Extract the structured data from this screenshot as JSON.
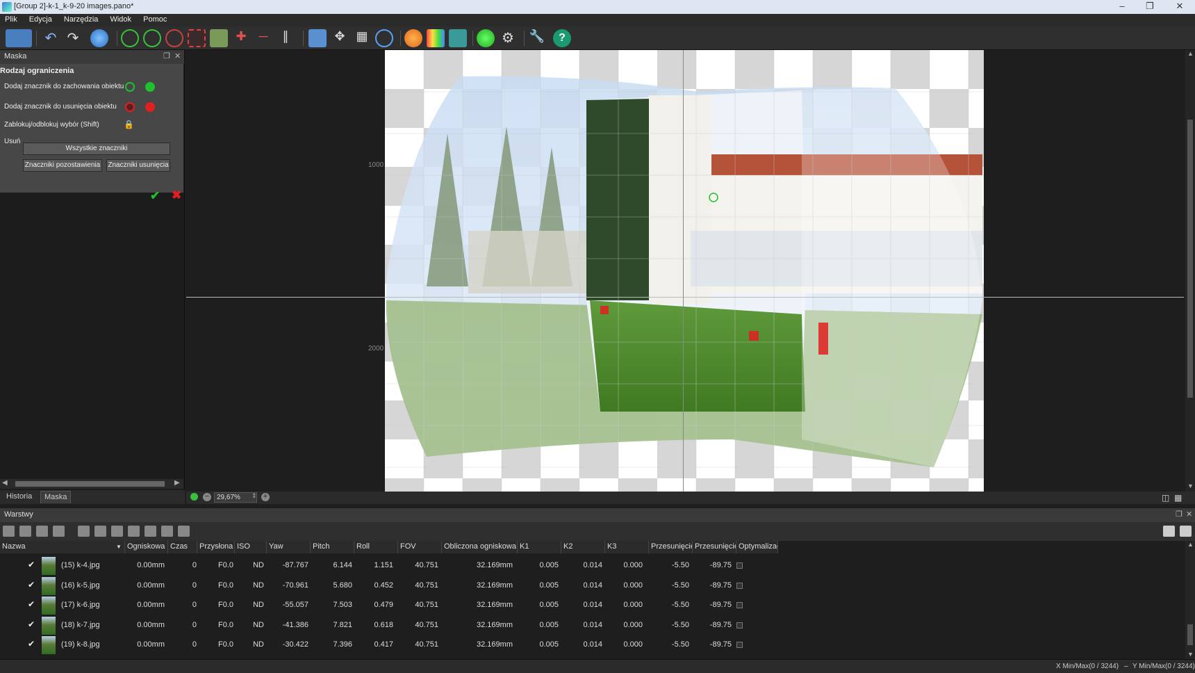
{
  "window": {
    "title": "[Group 2]-k-1_k-9-20 images.pano*"
  },
  "menu": [
    "Plik",
    "Edycja",
    "Narzędzia",
    "Widok",
    "Pomoc"
  ],
  "mask_panel": {
    "title": "Maska",
    "section_title": "Rodzaj ograniczenia",
    "keep_label": "Dodaj znacznik do zachowania obiektu",
    "remove_label": "Dodaj znacznik do usunięcia obiektu",
    "lock_label": "Zablokuj/odblokuj wybór (Shift)",
    "delete_label": "Usuń",
    "all_markers_button": "Wszystkie znaczniki",
    "keep_markers_button": "Znaczniki pozostawienia",
    "remove_markers_button": "Znaczniki usunięcia"
  },
  "left_tabs": [
    "Historia",
    "Maska"
  ],
  "viewport": {
    "ruler_labels": [
      "1000",
      "2000"
    ],
    "zoom": "29,67%"
  },
  "layers": {
    "title": "Warstwy",
    "columns": [
      "Nazwa",
      "Ogniskowa",
      "Czas",
      "Przysłona",
      "ISO",
      "Yaw",
      "Pitch",
      "Roll",
      "FOV",
      "Obliczona ogniskowa",
      "K1",
      "K2",
      "K3",
      "Przesunięcie",
      "Przesunięcie",
      "Optymalizac"
    ],
    "rows": [
      {
        "name": "(15) k-4.jpg",
        "focal": "0.00mm",
        "time": "0",
        "aperture": "F0.0",
        "iso": "ND",
        "yaw": "-87.767",
        "pitch": "6.144",
        "roll": "1.151",
        "fov": "40.751",
        "calc_focal": "32.169mm",
        "k1": "0.005",
        "k2": "0.014",
        "k3": "0.000",
        "shift1": "-5.50",
        "shift2": "-89.75"
      },
      {
        "name": "(16) k-5.jpg",
        "focal": "0.00mm",
        "time": "0",
        "aperture": "F0.0",
        "iso": "ND",
        "yaw": "-70.961",
        "pitch": "5.680",
        "roll": "0.452",
        "fov": "40.751",
        "calc_focal": "32.169mm",
        "k1": "0.005",
        "k2": "0.014",
        "k3": "0.000",
        "shift1": "-5.50",
        "shift2": "-89.75"
      },
      {
        "name": "(17) k-6.jpg",
        "focal": "0.00mm",
        "time": "0",
        "aperture": "F0.0",
        "iso": "ND",
        "yaw": "-55.057",
        "pitch": "7.503",
        "roll": "0.479",
        "fov": "40.751",
        "calc_focal": "32.169mm",
        "k1": "0.005",
        "k2": "0.014",
        "k3": "0.000",
        "shift1": "-5.50",
        "shift2": "-89.75"
      },
      {
        "name": "(18) k-7.jpg",
        "focal": "0.00mm",
        "time": "0",
        "aperture": "F0.0",
        "iso": "ND",
        "yaw": "-41.386",
        "pitch": "7.821",
        "roll": "0.618",
        "fov": "40.751",
        "calc_focal": "32.169mm",
        "k1": "0.005",
        "k2": "0.014",
        "k3": "0.000",
        "shift1": "-5.50",
        "shift2": "-89.75"
      },
      {
        "name": "(19) k-8.jpg",
        "focal": "0.00mm",
        "time": "0",
        "aperture": "F0.0",
        "iso": "ND",
        "yaw": "-30.422",
        "pitch": "7.396",
        "roll": "0.417",
        "fov": "40.751",
        "calc_focal": "32.169mm",
        "k1": "0.005",
        "k2": "0.014",
        "k3": "0.000",
        "shift1": "-5.50",
        "shift2": "-89.75"
      }
    ]
  },
  "status": {
    "x_minmax": "X Min/Max(0 / 3244)",
    "y_minmax": "Y Min/Max(0 / 3244)"
  },
  "colors": {
    "keep": "#20c030",
    "remove": "#e02020",
    "accent": "#3a7bd5"
  },
  "icons": {
    "toolbar": [
      "new-project-icon",
      "undo-icon",
      "redo-icon",
      "globe-icon",
      "crosshair-icon",
      "crosshair-icon",
      "crosshair-icon",
      "mask-icon",
      "crop-icon",
      "move-icon",
      "horizon-icon",
      "split-icon",
      "preview-icon",
      "pan-icon",
      "grid-icon",
      "target-icon",
      "auto-icon",
      "color-icon",
      "layers-icon",
      "render-icon",
      "settings-icon",
      "wrench-icon",
      "help-icon"
    ]
  }
}
